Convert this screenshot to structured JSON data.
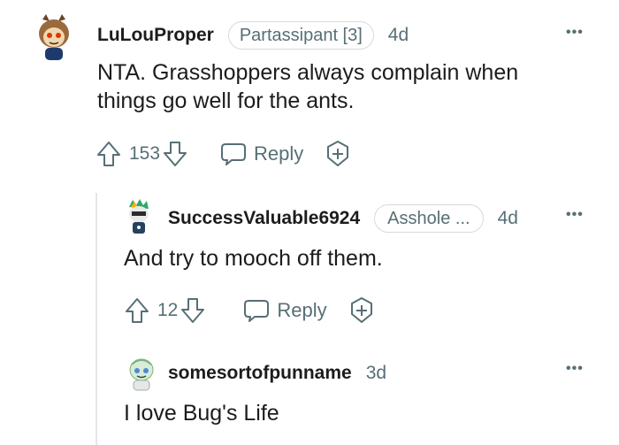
{
  "comments": [
    {
      "username": "LuLouProper",
      "flair": "Partassipant [3]",
      "age": "4d",
      "body": "NTA. Grasshoppers always complain when things go well for the ants.",
      "votes": "153",
      "reply_label": "Reply",
      "more_label": "•••"
    },
    {
      "username": "SuccessValuable6924",
      "flair": "Asshole ...",
      "age": "4d",
      "body": "And try to mooch off them.",
      "votes": "12",
      "reply_label": "Reply",
      "more_label": "•••"
    },
    {
      "username": "somesortofpunname",
      "age": "3d",
      "body": "I love Bug's Life",
      "more_label": "•••"
    }
  ],
  "colors": {
    "text": "#1c1c1c",
    "muted": "#576f76",
    "border": "#d7dadc",
    "thread": "#e3e6e8"
  },
  "icons": [
    "avatar",
    "upvote-icon",
    "downvote-icon",
    "reply-icon",
    "award-icon",
    "more-icon"
  ]
}
